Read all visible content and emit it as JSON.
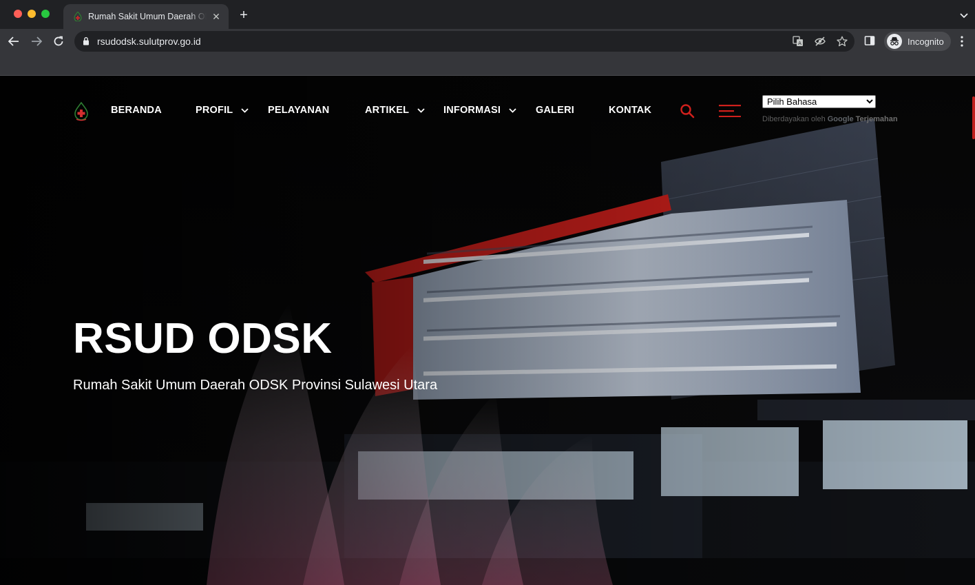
{
  "browser": {
    "tab": {
      "title": "Rumah Sakit Umum Daerah ODSK Provinsi Sulawesi Utara"
    },
    "address": {
      "url": "rsudodsk.sulutprov.go.id"
    },
    "profile_label": "Incognito"
  },
  "site": {
    "nav": [
      {
        "label": "BERANDA",
        "dropdown": false
      },
      {
        "label": "PROFIL",
        "dropdown": true
      },
      {
        "label": "PELAYANAN",
        "dropdown": false
      },
      {
        "label": "ARTIKEL",
        "dropdown": true
      },
      {
        "label": "INFORMASI",
        "dropdown": true
      },
      {
        "label": "GALERI",
        "dropdown": false
      },
      {
        "label": "KONTAK",
        "dropdown": false
      }
    ],
    "translate": {
      "selected": "Pilih Bahasa",
      "powered_by": "Diberdayakan oleh",
      "brand": "Google",
      "link": "Terjemahan"
    },
    "hero": {
      "title": "RSUD ODSK",
      "subtitle": "Rumah Sakit Umum Daerah ODSK Provinsi Sulawesi Utara"
    }
  },
  "colors": {
    "accent": "#d0201c",
    "chrome_dark": "#202124",
    "chrome_toolbar": "#35363a"
  }
}
